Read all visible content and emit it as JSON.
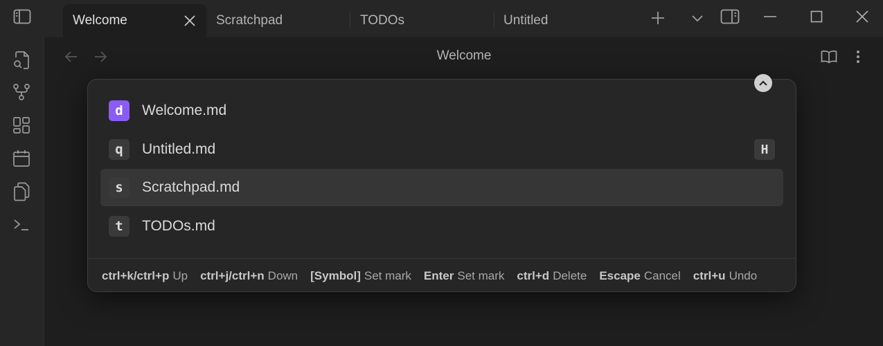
{
  "tabs": [
    {
      "label": "Welcome",
      "active": true
    },
    {
      "label": "Scratchpad",
      "active": false
    },
    {
      "label": "TODOs",
      "active": false
    },
    {
      "label": "Untitled",
      "active": false
    }
  ],
  "header": {
    "title": "Welcome"
  },
  "sidebar": {
    "icons": [
      "open-file-icon",
      "graph-icon",
      "canvas-icon",
      "calendar-icon",
      "copy-icon",
      "terminal-icon"
    ]
  },
  "switcher": {
    "items": [
      {
        "key": "d",
        "label": "Welcome.md",
        "accent": true,
        "selected": false,
        "hint": ""
      },
      {
        "key": "q",
        "label": "Untitled.md",
        "accent": false,
        "selected": false,
        "hint": "H"
      },
      {
        "key": "s",
        "label": "Scratchpad.md",
        "accent": false,
        "selected": true,
        "hint": ""
      },
      {
        "key": "t",
        "label": "TODOs.md",
        "accent": false,
        "selected": false,
        "hint": ""
      }
    ],
    "instructions": [
      {
        "key": "ctrl+k/ctrl+p",
        "action": "Up"
      },
      {
        "key": "ctrl+j/ctrl+n",
        "action": "Down"
      },
      {
        "key": "[Symbol]",
        "action": "Set mark"
      },
      {
        "key": "Enter",
        "action": "Set mark"
      },
      {
        "key": "ctrl+d",
        "action": "Delete"
      },
      {
        "key": "Escape",
        "action": "Cancel"
      },
      {
        "key": "ctrl+u",
        "action": "Undo"
      }
    ]
  },
  "colors": {
    "accent": "#8a5cf5",
    "background": "#1e1e1e",
    "titlebar": "#262626"
  }
}
